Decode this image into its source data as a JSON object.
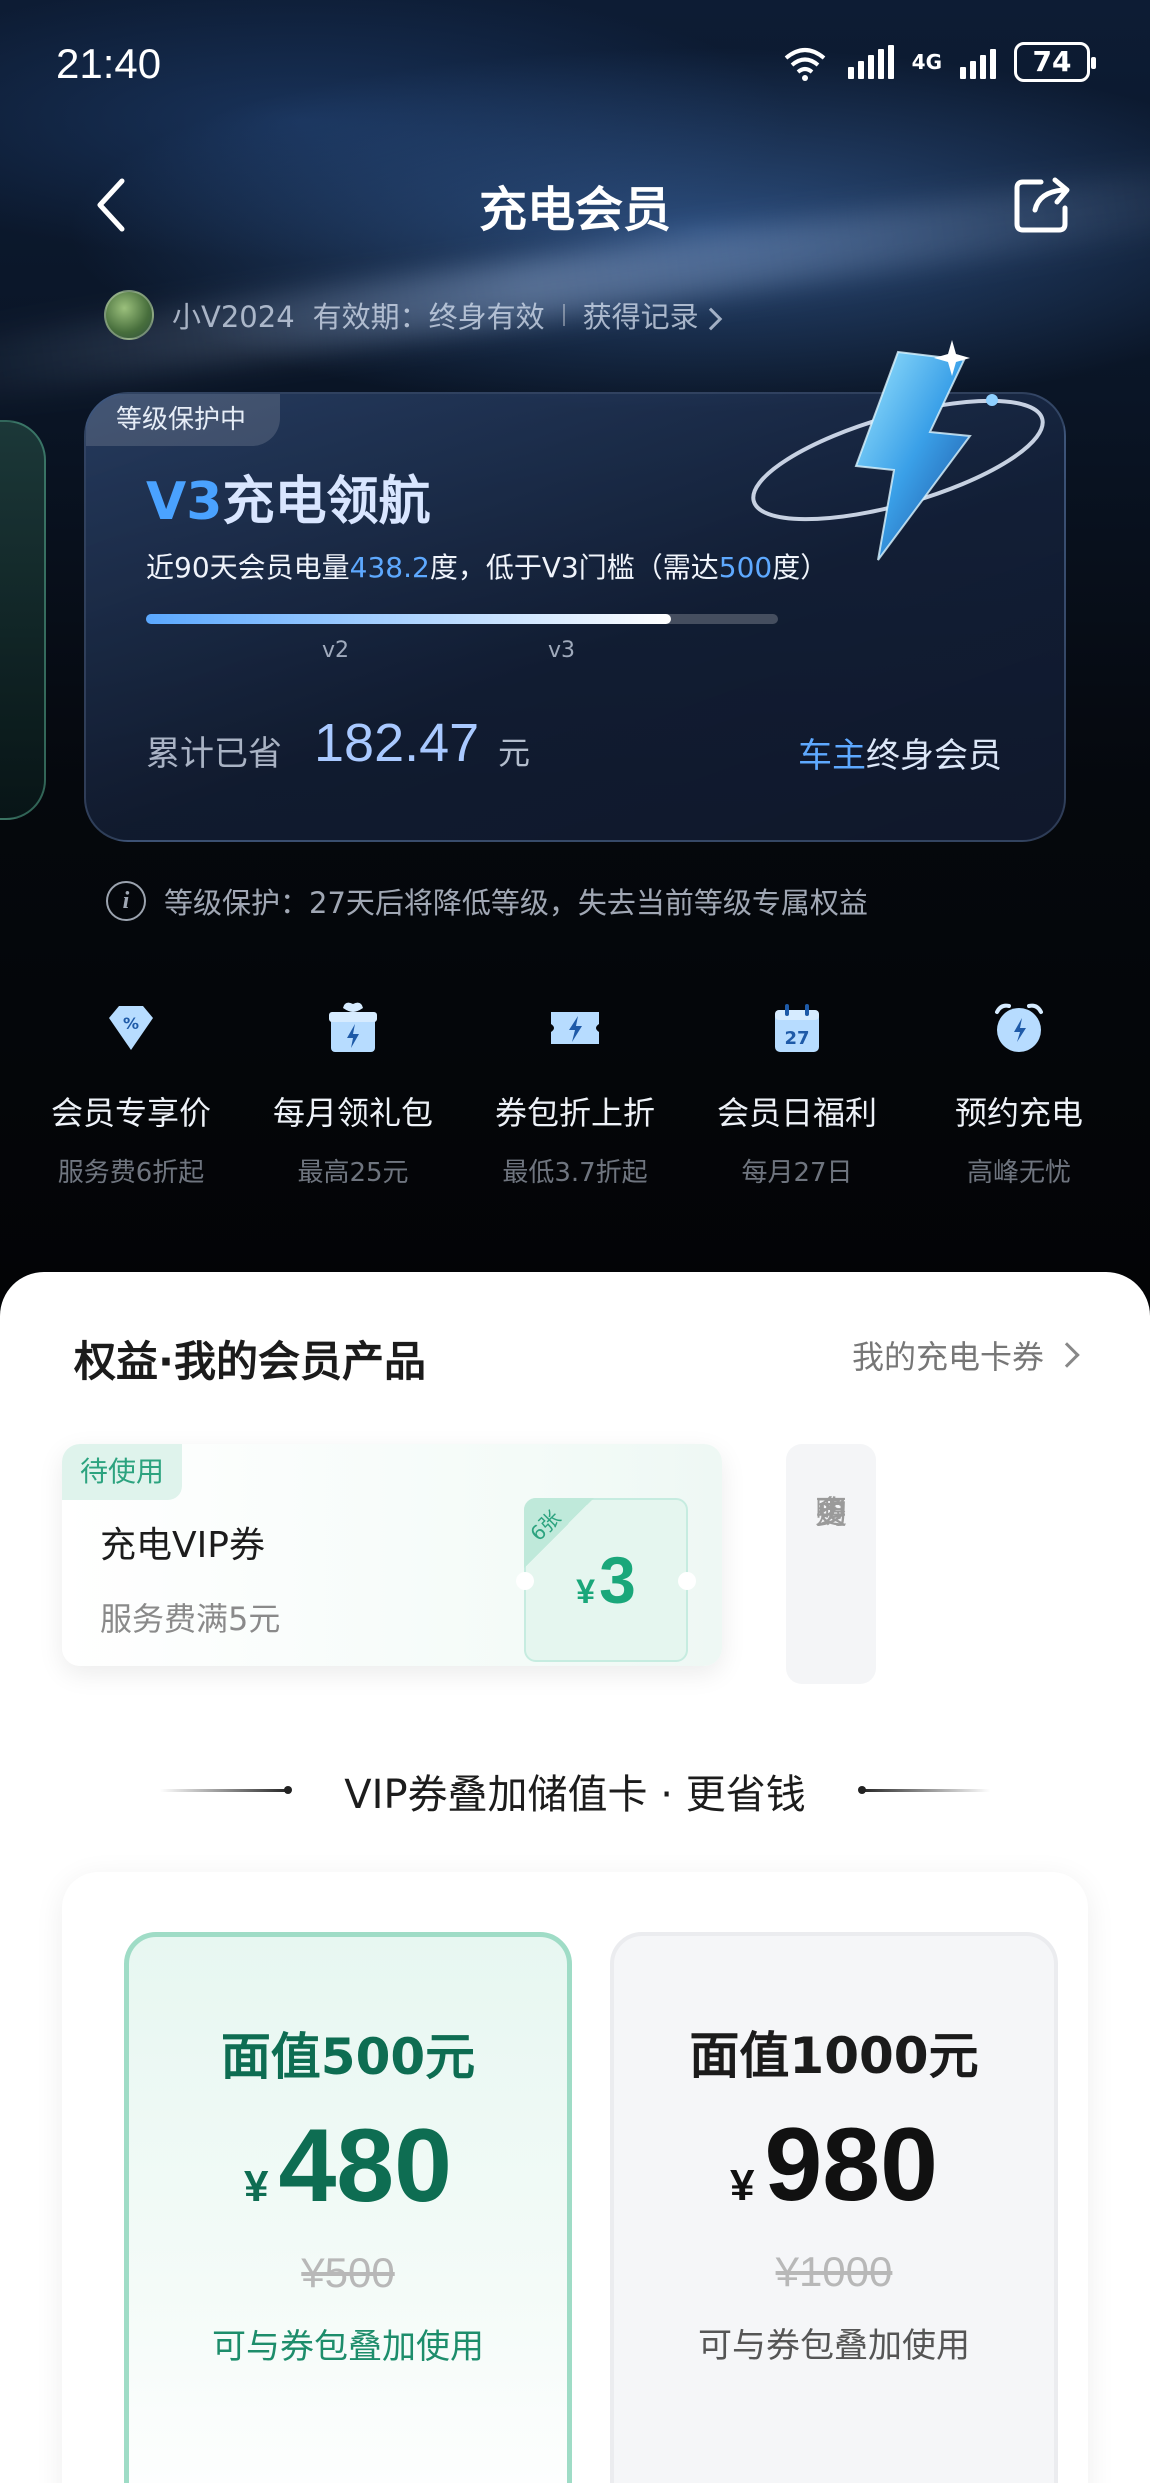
{
  "status_bar": {
    "time": "21:40",
    "wifi_label": "6",
    "network": "4G",
    "battery": "74"
  },
  "nav": {
    "title": "充电会员",
    "back_icon": "back-arrow-icon",
    "share_icon": "share-icon"
  },
  "user": {
    "name": "小V2024",
    "validity": "有效期：终身有效",
    "records_link": "获得记录"
  },
  "level_card": {
    "protection_badge": "等级保护中",
    "level_code": "V3",
    "level_title": "充电领航",
    "desc_prefix": "近90天会员电量",
    "desc_value": "438.2",
    "desc_mid": "度，低于V3门槛（需达",
    "desc_threshold": "500",
    "desc_suffix": "度）",
    "progress": 0.83,
    "tick_v2": "v2",
    "tick_v3": "v3",
    "saved_label": "累计已省",
    "saved_value": "182.47",
    "saved_unit": "元",
    "member_type_a": "车主",
    "member_type_b": "终身会员"
  },
  "notice": {
    "text": "等级保护：27天后将降低等级，失去当前等级专属权益"
  },
  "benefits": [
    {
      "icon": "discount-diamond-icon",
      "title": "会员专享价",
      "sub": "服务费6折起"
    },
    {
      "icon": "gift-box-icon",
      "title": "每月领礼包",
      "sub": "最高25元"
    },
    {
      "icon": "coupon-bolt-icon",
      "title": "券包折上折",
      "sub": "最低3.7折起"
    },
    {
      "icon": "calendar-27-icon",
      "title": "会员日福利",
      "sub": "每月27日"
    },
    {
      "icon": "alarm-clock-icon",
      "title": "预约充电",
      "sub": "高峰无忧"
    }
  ],
  "products": {
    "title": "权益·我的会员产品",
    "link": "我的充电卡券",
    "coupon": {
      "status": "待使用",
      "name": "充电VIP券",
      "condition": "服务费满5元",
      "count_tag": "6张",
      "currency": "¥",
      "amount": "3"
    },
    "more": [
      "购",
      "买",
      "更",
      "多"
    ]
  },
  "stored_value": {
    "title": "VIP券叠加储值卡 · 更省钱",
    "cards": [
      {
        "face": "面值500元",
        "currency": "¥",
        "price": "480",
        "original": "¥500",
        "note": "可与券包叠加使用"
      },
      {
        "face": "面值1000元",
        "currency": "¥",
        "price": "980",
        "original": "¥1000",
        "note": "可与券包叠加使用"
      }
    ]
  },
  "colors": {
    "accent_blue": "#4aa2ff",
    "accent_green": "#1aa77a",
    "dark_green": "#0e6d52"
  }
}
